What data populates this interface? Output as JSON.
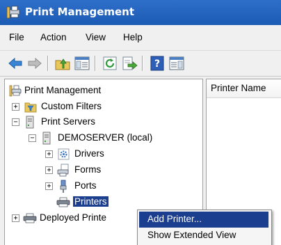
{
  "window": {
    "title": "Print Management"
  },
  "menu": [
    "File",
    "Action",
    "View",
    "Help"
  ],
  "toolbar": {
    "buttons": [
      "back-arrow-icon",
      "forward-arrow-icon",
      "up-folder-icon",
      "show-hide-tree-icon",
      "refresh-icon",
      "export-list-icon",
      "help-icon",
      "show-hide-action-pane-icon"
    ]
  },
  "tree": {
    "root": "Print Management",
    "custom_filters": "Custom Filters",
    "print_servers": "Print Servers",
    "server": "DEMOSERVER (local)",
    "drivers": "Drivers",
    "forms": "Forms",
    "ports": "Ports",
    "printers": "Printers",
    "deployed": "Deployed Printe",
    "expander_plus": "+",
    "expander_minus": "−"
  },
  "list": {
    "column_header": "Printer Name"
  },
  "context_menu": {
    "items": [
      "Add Printer...",
      "Show Extended View"
    ],
    "highlighted_index": 0
  }
}
